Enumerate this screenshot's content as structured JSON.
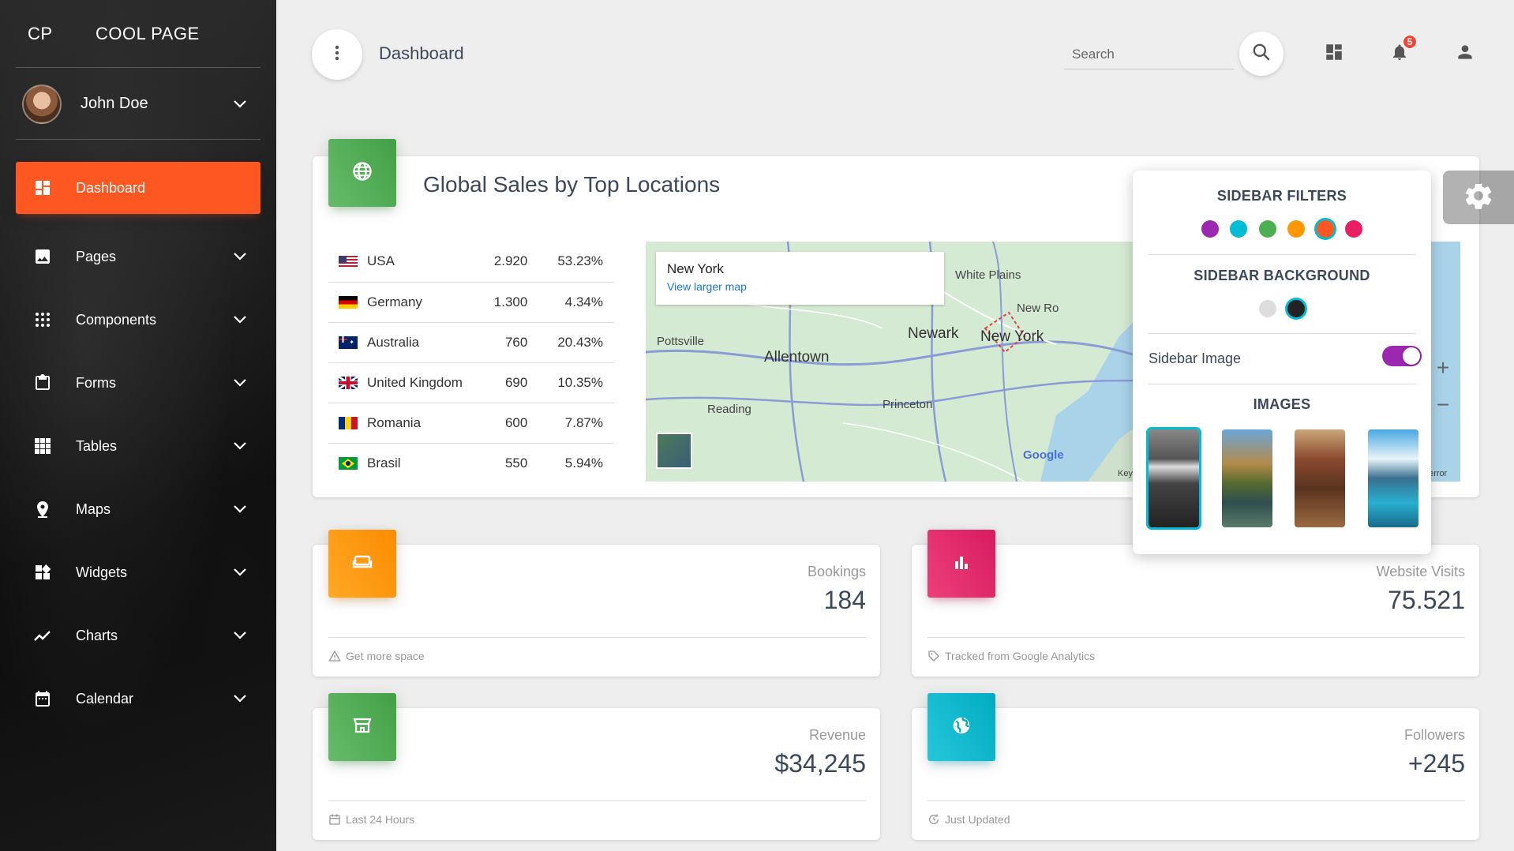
{
  "brand": {
    "mini": "CP",
    "full": "COOL PAGE"
  },
  "user": {
    "name": "John Doe"
  },
  "nav": [
    {
      "label": "Dashboard",
      "icon": "dashboard-icon",
      "active": true
    },
    {
      "label": "Pages",
      "icon": "image-icon"
    },
    {
      "label": "Components",
      "icon": "apps-icon"
    },
    {
      "label": "Forms",
      "icon": "clipboard-icon"
    },
    {
      "label": "Tables",
      "icon": "grid-icon"
    },
    {
      "label": "Maps",
      "icon": "place-icon"
    },
    {
      "label": "Widgets",
      "icon": "widgets-icon"
    },
    {
      "label": "Charts",
      "icon": "timeline-icon"
    },
    {
      "label": "Calendar",
      "icon": "calendar-icon"
    }
  ],
  "topbar": {
    "title": "Dashboard",
    "search_placeholder": "Search",
    "notifications_count": "5"
  },
  "sales": {
    "title": "Global Sales by Top Locations",
    "rows": [
      {
        "country": "USA",
        "value": "2.920",
        "percent": "53.23%"
      },
      {
        "country": "Germany",
        "value": "1.300",
        "percent": "4.34%"
      },
      {
        "country": "Australia",
        "value": "760",
        "percent": "20.43%"
      },
      {
        "country": "United Kingdom",
        "value": "690",
        "percent": "10.35%"
      },
      {
        "country": "Romania",
        "value": "600",
        "percent": "7.87%"
      },
      {
        "country": "Brasil",
        "value": "550",
        "percent": "5.94%"
      }
    ],
    "map": {
      "info_title": "New York",
      "info_link": "View larger map",
      "labels": [
        "White Plains",
        "Newark",
        "New York",
        "Allentown",
        "Pottsville",
        "Reading",
        "Princeton",
        "New Ro",
        "Google",
        "Key",
        "error"
      ],
      "zoom_in": "+",
      "zoom_out": "−"
    }
  },
  "stats": [
    {
      "title": "Bookings",
      "value": "184",
      "footer": "Get more space",
      "color": "orange"
    },
    {
      "title": "Website Visits",
      "value": "75.521",
      "footer": "Tracked from Google Analytics",
      "color": "rose"
    },
    {
      "title": "Revenue",
      "value": "$34,245",
      "footer": "Last 24 Hours",
      "color": "green"
    },
    {
      "title": "Followers",
      "value": "+245",
      "footer": "Just Updated",
      "color": "cyan"
    }
  ],
  "plugin": {
    "filters_title": "SIDEBAR FILTERS",
    "filter_colors": [
      "#9c27b0",
      "#00bcd4",
      "#4caf50",
      "#ff9800",
      "#ff5722",
      "#e91e63"
    ],
    "selected_filter": "#ff5722",
    "background_title": "SIDEBAR BACKGROUND",
    "background_colors": [
      "#dddddd",
      "#222222"
    ],
    "selected_background": "#222222",
    "sidebar_image_label": "Sidebar Image",
    "sidebar_image_on": true,
    "images_title": "IMAGES"
  }
}
